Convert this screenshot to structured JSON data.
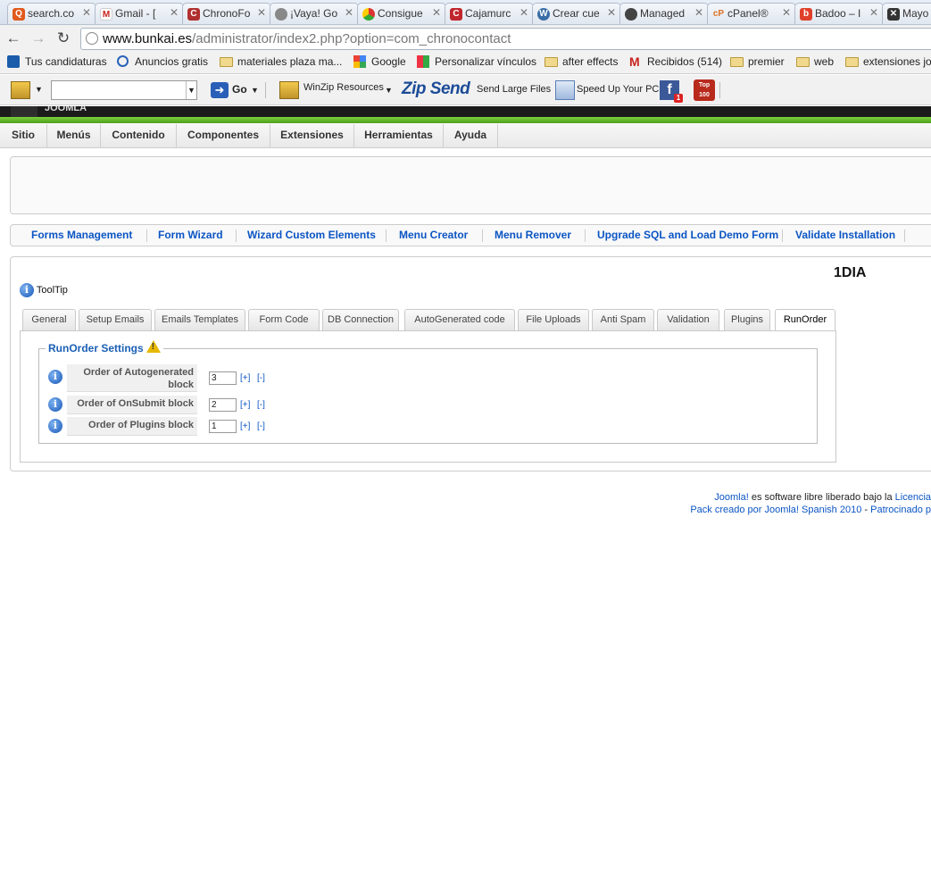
{
  "browser": {
    "tabs": [
      {
        "label": "search.co",
        "favicon": "search-icon",
        "color": "#e05a1c"
      },
      {
        "label": "Gmail - [",
        "favicon": "gmail-icon",
        "color": "#c8231e"
      },
      {
        "label": "ChronoFo",
        "favicon": "chronoforms-icon",
        "color": "#b03030"
      },
      {
        "label": "¡Vaya! Go",
        "favicon": "globe-icon",
        "color": "#888888"
      },
      {
        "label": "Consigue",
        "favicon": "chrome-icon",
        "color": "#3a8f3a"
      },
      {
        "label": "Cajamurc",
        "favicon": "bank-icon",
        "color": "#c0262c"
      },
      {
        "label": "Crear cue",
        "favicon": "wordpress-icon",
        "color": "#3b6ea5"
      },
      {
        "label": "Managed",
        "favicon": "managed-icon",
        "color": "#444444"
      },
      {
        "label": "cPanel®",
        "favicon": "cpanel-icon",
        "color": "#e07020"
      },
      {
        "label": "Badoo – I",
        "favicon": "badoo-icon",
        "color": "#e0402a"
      },
      {
        "label": "Mayo",
        "favicon": "joomla-icon",
        "color": "#333333"
      }
    ],
    "url_host": "www.bunkai.es",
    "url_path": "/administrator/index2.php?option=com_chronocontact"
  },
  "bookmarks": [
    {
      "label": "Tus candidaturas",
      "icon": "infojobs-icon"
    },
    {
      "label": "Anuncios gratis",
      "icon": "anuncios-icon"
    },
    {
      "label": "materiales plaza ma...",
      "icon": "folder-icon"
    },
    {
      "label": "Google",
      "icon": "google-icon"
    },
    {
      "label": "Personalizar vínculos",
      "icon": "windows-icon"
    },
    {
      "label": "after effects",
      "icon": "folder-icon"
    },
    {
      "label": "Recibidos (514)",
      "icon": "gmail-icon"
    },
    {
      "label": "premier",
      "icon": "folder-icon"
    },
    {
      "label": "web",
      "icon": "folder-icon"
    },
    {
      "label": "extensiones joo",
      "icon": "folder-icon"
    }
  ],
  "toolbar": {
    "go_label": "Go",
    "winzip_label": "WinZip Resources",
    "zipsend_label": "Zip Send",
    "send_large_label": "Send Large Files",
    "speedup_label": "Speed Up Your PC",
    "fb_badge": "1",
    "top100_label": "Top 100"
  },
  "joomla": {
    "logo": "JOOMLA",
    "main_menu": [
      "Sitio",
      "Menús",
      "Contenido",
      "Componentes",
      "Extensiones",
      "Herramientas",
      "Ayuda"
    ],
    "submenu": [
      "Forms Management",
      "Form Wizard",
      "Wizard Custom Elements",
      "Menu Creator",
      "Menu Remover",
      "Upgrade SQL and Load Demo Form",
      "Validate Installation"
    ],
    "form_title": "1DIA",
    "tooltip_label": "ToolTip",
    "tabs": [
      "General",
      "Setup Emails",
      "Emails Templates",
      "Form Code",
      "DB Connection",
      "AutoGenerated code",
      "File Uploads",
      "Anti Spam",
      "Validation",
      "Plugins",
      "RunOrder"
    ],
    "active_tab": "RunOrder",
    "section_title": "RunOrder Settings",
    "fields": [
      {
        "label": "Order of Autogenerated block",
        "value": "3",
        "plus": "[+]",
        "minus": "[-]"
      },
      {
        "label": "Order of OnSubmit block",
        "value": "2",
        "plus": "[+]",
        "minus": "[-]"
      },
      {
        "label": "Order of Plugins block",
        "value": "1",
        "plus": "[+]",
        "minus": "[-]"
      }
    ],
    "footer": {
      "line1_link": "Joomla!",
      "line1_text": " es software libre liberado bajo la ",
      "line1_link2": "Licencia",
      "line2_link": "Pack creado por Joomla! Spanish 2010",
      "line2_sep": " - ",
      "line2_link2": "Patrocinado p"
    }
  },
  "colors": {
    "link": "#0b55c4",
    "accent_green": "#5aad24",
    "header_dark": "#1b1b1b"
  }
}
